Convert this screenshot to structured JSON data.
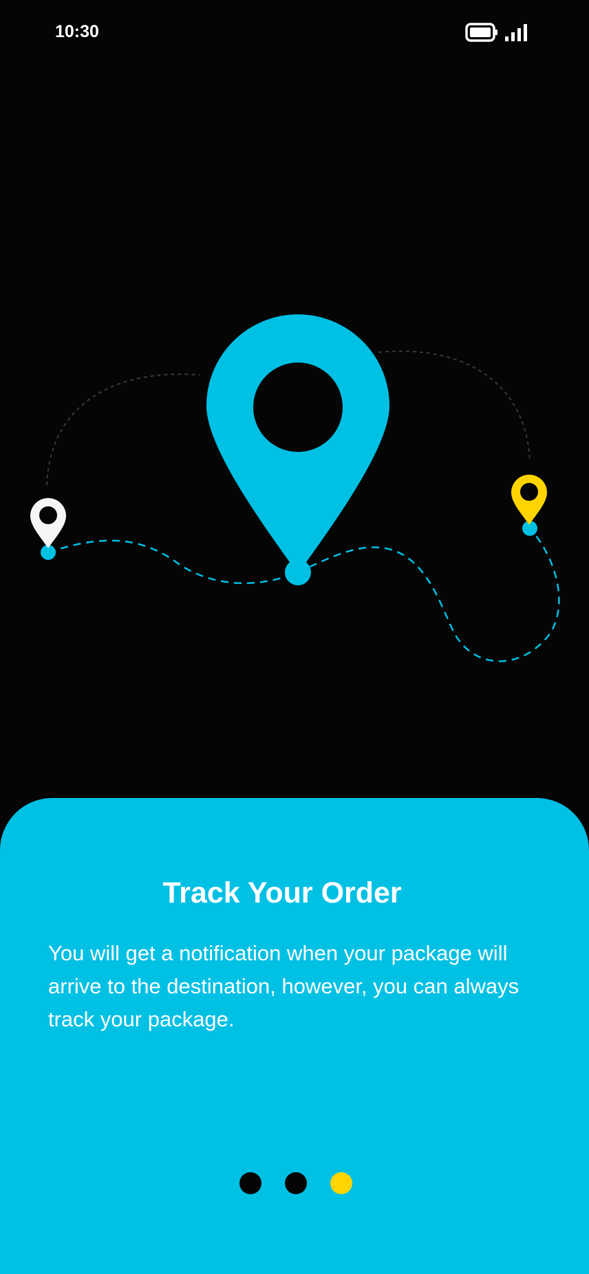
{
  "status_bar": {
    "time": "10:30",
    "icons": [
      "battery-icon",
      "signal-icon"
    ]
  },
  "illustration": {
    "icons": [
      "location-pin-large-icon",
      "location-pin-white-icon",
      "location-pin-yellow-icon"
    ],
    "colors": {
      "primary": "#00c0e4",
      "accent": "#ffd400",
      "pin_white": "#f5f5f7",
      "background": "#050506"
    }
  },
  "onboarding": {
    "title": "Track Your Order",
    "description": "You will get a notification when your package will arrive to the destination, however, you can always track your package.",
    "pagination": {
      "total": 3,
      "active_index": 2,
      "active_color": "#ffd400",
      "inactive_color": "#050506"
    }
  }
}
